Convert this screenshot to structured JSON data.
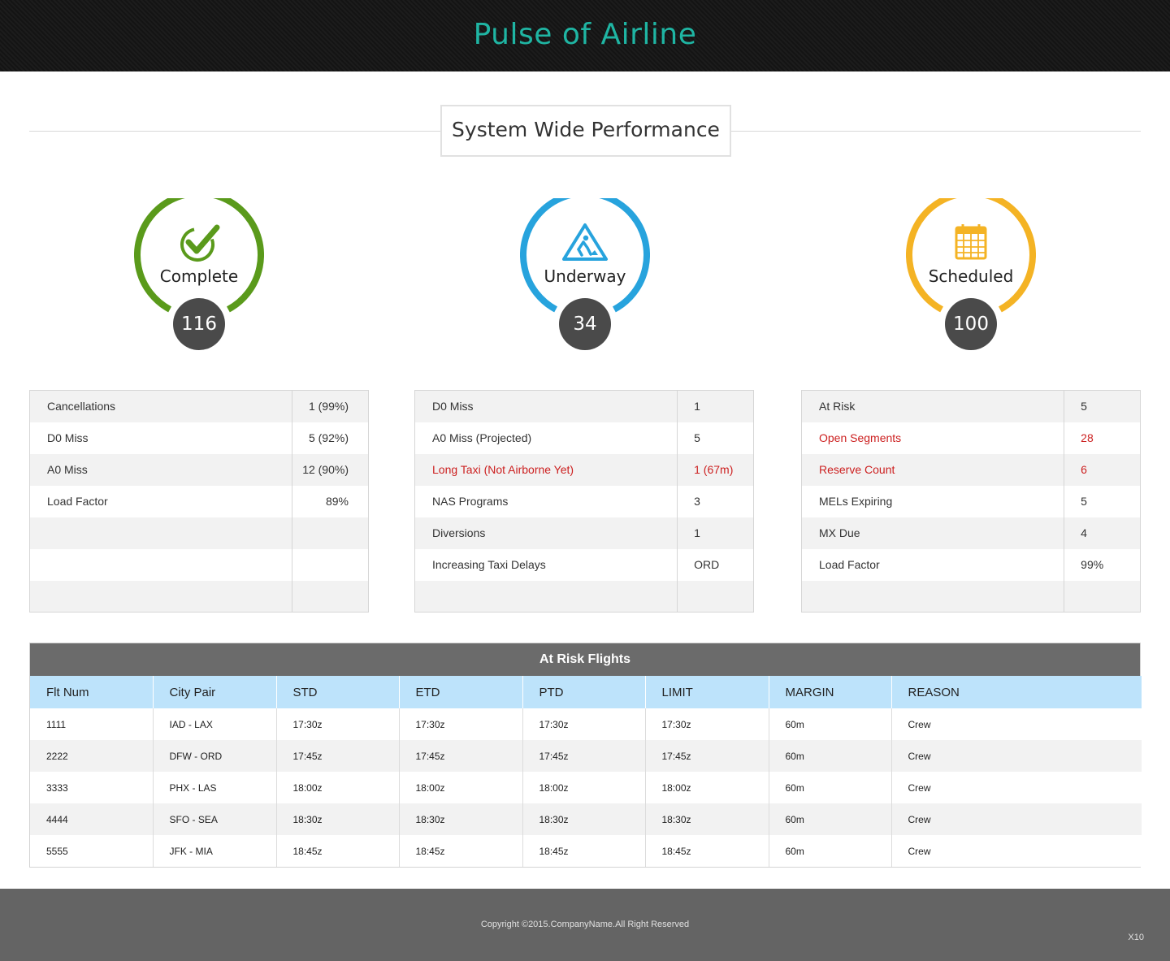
{
  "header": {
    "title": "Pulse of Airline"
  },
  "section": {
    "title": "System Wide Performance"
  },
  "gauges": [
    {
      "label": "Complete",
      "count": "116",
      "color": "#5a9a1b",
      "icon": "check-badge-icon"
    },
    {
      "label": "Underway",
      "count": "34",
      "color": "#27a3dd",
      "icon": "road-work-icon"
    },
    {
      "label": "Scheduled",
      "count": "100",
      "color": "#f4b324",
      "icon": "calendar-icon"
    }
  ],
  "complete_stats": {
    "rows": [
      {
        "label": "Cancellations",
        "value": "1 (99%)"
      },
      {
        "label": "D0 Miss",
        "value": "5 (92%)"
      },
      {
        "label": "A0 Miss",
        "value": "12 (90%)"
      },
      {
        "label": "Load Factor",
        "value": "89%"
      },
      {
        "label": "",
        "value": ""
      },
      {
        "label": "",
        "value": ""
      },
      {
        "label": "",
        "value": ""
      }
    ]
  },
  "underway_stats": {
    "rows": [
      {
        "label": "D0 Miss",
        "value": "1"
      },
      {
        "label": "A0 Miss (Projected)",
        "value": "5"
      },
      {
        "label": "Long Taxi (Not Airborne Yet)",
        "value": "1 (67m)",
        "alert": true
      },
      {
        "label": "NAS Programs",
        "value": "3"
      },
      {
        "label": "Diversions",
        "value": "1"
      },
      {
        "label": "Increasing Taxi Delays",
        "value": "ORD"
      },
      {
        "label": "",
        "value": ""
      }
    ]
  },
  "scheduled_stats": {
    "rows": [
      {
        "label": "At Risk",
        "value": "5"
      },
      {
        "label": "Open Segments",
        "value": "28",
        "alert": true
      },
      {
        "label": "Reserve Count",
        "value": "6",
        "alert": true
      },
      {
        "label": "MELs Expiring",
        "value": "5"
      },
      {
        "label": "MX Due",
        "value": "4"
      },
      {
        "label": "Load Factor",
        "value": "99%"
      },
      {
        "label": "",
        "value": ""
      }
    ]
  },
  "at_risk": {
    "title": "At Risk Flights",
    "columns": [
      "Flt Num",
      "City Pair",
      "STD",
      "ETD",
      "PTD",
      "LIMIT",
      "MARGIN",
      "REASON"
    ],
    "rows": [
      [
        "1111",
        "IAD - LAX",
        "17:30z",
        "17:30z",
        "17:30z",
        "17:30z",
        "60m",
        "Crew"
      ],
      [
        "2222",
        "DFW - ORD",
        "17:45z",
        "17:45z",
        "17:45z",
        "17:45z",
        "60m",
        "Crew"
      ],
      [
        "3333",
        "PHX - LAS",
        "18:00z",
        "18:00z",
        "18:00z",
        "18:00z",
        "60m",
        "Crew"
      ],
      [
        "4444",
        "SFO - SEA",
        "18:30z",
        "18:30z",
        "18:30z",
        "18:30z",
        "60m",
        "Crew"
      ],
      [
        "5555",
        "JFK - MIA",
        "18:45z",
        "18:45z",
        "18:45z",
        "18:45z",
        "60m",
        "Crew"
      ]
    ]
  },
  "footer": {
    "copyright": "Copyright ©2015.CompanyName.All Right Reserved",
    "version": "X10"
  },
  "colors": {
    "accent": "#1fb5a3",
    "alert": "#cc1f1f",
    "table_header": "#bde3fb"
  }
}
